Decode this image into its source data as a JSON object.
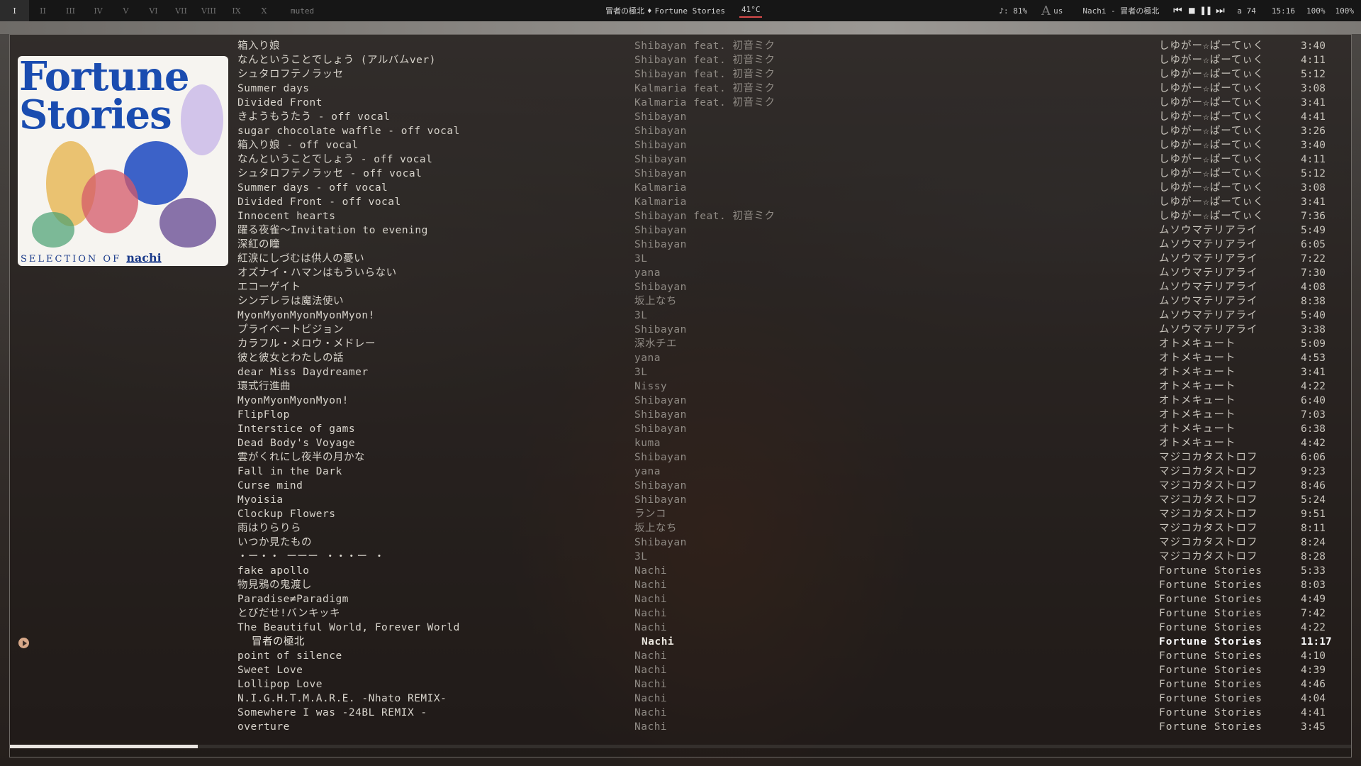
{
  "topbar": {
    "workspaces": [
      "I",
      "II",
      "III",
      "IV",
      "V",
      "VI",
      "VII",
      "VIII",
      "IX",
      "X"
    ],
    "active_workspace": "I",
    "mute_label": "muted",
    "now_playing_title": "冒者の極北",
    "now_playing_sep": "♦",
    "now_playing_album": "Fortune Stories",
    "temperature": "41°C",
    "volume_label": "♪: 81%",
    "keyboard_layout": "us",
    "window_title": "Nachi - 冒者の極北",
    "workspace_count": "a 74",
    "clock": "15:16",
    "brightness": "100%",
    "battery": "100%"
  },
  "album_art": {
    "title_line1": "Fortune",
    "title_line2": "Stories",
    "subtitle": "SELECTION OF",
    "artist": "nachi"
  },
  "playback": {
    "progress": 0.14
  },
  "tracks": [
    {
      "title": "箱入り娘",
      "artist": "Shibayan feat. 初音ミク",
      "album": "しゆがー☆ぱーてぃく",
      "duration": "3:40"
    },
    {
      "title": "なんということでしょう (アルバムver)",
      "artist": "Shibayan feat. 初音ミク",
      "album": "しゆがー☆ぱーてぃく",
      "duration": "4:11"
    },
    {
      "title": "シュタロフテノラッセ",
      "artist": "Shibayan feat. 初音ミク",
      "album": "しゆがー☆ぱーてぃく",
      "duration": "5:12"
    },
    {
      "title": "Summer days",
      "artist": "Kalmaria feat. 初音ミク",
      "album": "しゆがー☆ぱーてぃく",
      "duration": "3:08"
    },
    {
      "title": "Divided Front",
      "artist": "Kalmaria feat. 初音ミク",
      "album": "しゆがー☆ぱーてぃく",
      "duration": "3:41"
    },
    {
      "title": "きようもうたう - off vocal",
      "artist": "Shibayan",
      "album": "しゆがー☆ぱーてぃく",
      "duration": "4:41"
    },
    {
      "title": "sugar chocolate waffle - off vocal",
      "artist": "Shibayan",
      "album": "しゆがー☆ぱーてぃく",
      "duration": "3:26"
    },
    {
      "title": "箱入り娘 - off vocal",
      "artist": "Shibayan",
      "album": "しゆがー☆ぱーてぃく",
      "duration": "3:40"
    },
    {
      "title": "なんということでしょう - off vocal",
      "artist": "Shibayan",
      "album": "しゆがー☆ぱーてぃく",
      "duration": "4:11"
    },
    {
      "title": "シュタロフテノラッセ - off vocal",
      "artist": "Shibayan",
      "album": "しゆがー☆ぱーてぃく",
      "duration": "5:12"
    },
    {
      "title": "Summer days - off vocal",
      "artist": "Kalmaria",
      "album": "しゆがー☆ぱーてぃく",
      "duration": "3:08"
    },
    {
      "title": "Divided Front - off vocal",
      "artist": "Kalmaria",
      "album": "しゆがー☆ぱーてぃく",
      "duration": "3:41"
    },
    {
      "title": "Innocent hearts",
      "artist": "Shibayan feat. 初音ミク",
      "album": "しゆがー☆ぱーてぃく",
      "duration": "7:36"
    },
    {
      "title": "躍る夜雀〜Invitation to evening",
      "artist": "Shibayan",
      "album": "ムソウマテリアライ",
      "duration": "5:49"
    },
    {
      "title": "深紅の瞳",
      "artist": "Shibayan",
      "album": "ムソウマテリアライ",
      "duration": "6:05"
    },
    {
      "title": "紅涙にしづむは供人の憂い",
      "artist": "3L",
      "album": "ムソウマテリアライ",
      "duration": "7:22"
    },
    {
      "title": "オズナイ・ハマンはもういらない",
      "artist": "yana",
      "album": "ムソウマテリアライ",
      "duration": "7:30"
    },
    {
      "title": "エコーゲイト",
      "artist": "Shibayan",
      "album": "ムソウマテリアライ",
      "duration": "4:08"
    },
    {
      "title": "シンデレラは魔法使い",
      "artist": "坂上なち",
      "album": "ムソウマテリアライ",
      "duration": "8:38"
    },
    {
      "title": "MyonMyonMyonMyonMyon!",
      "artist": "3L",
      "album": "ムソウマテリアライ",
      "duration": "5:40"
    },
    {
      "title": "プライベートビジョン",
      "artist": "Shibayan",
      "album": "ムソウマテリアライ",
      "duration": "3:38"
    },
    {
      "title": "カラフル・メロウ・メドレー",
      "artist": "深水チエ",
      "album": "オトメキュート",
      "duration": "5:09"
    },
    {
      "title": "彼と彼女とわたしの話",
      "artist": "yana",
      "album": "オトメキュート",
      "duration": "4:53"
    },
    {
      "title": "dear Miss Daydreamer",
      "artist": "3L",
      "album": "オトメキュート",
      "duration": "3:41"
    },
    {
      "title": "環式行進曲",
      "artist": "Nissy",
      "album": "オトメキュート",
      "duration": "4:22"
    },
    {
      "title": "MyonMyonMyonMyon!",
      "artist": "Shibayan",
      "album": "オトメキュート",
      "duration": "6:40"
    },
    {
      "title": "FlipFlop",
      "artist": "Shibayan",
      "album": "オトメキュート",
      "duration": "7:03"
    },
    {
      "title": "Interstice of gams",
      "artist": "Shibayan",
      "album": "オトメキュート",
      "duration": "6:38"
    },
    {
      "title": "Dead Body's Voyage",
      "artist": "kuma",
      "album": "オトメキュート",
      "duration": "4:42"
    },
    {
      "title": "雲がくれにし夜半の月かな",
      "artist": "Shibayan",
      "album": "マジコカタストロフ",
      "duration": "6:06"
    },
    {
      "title": "Fall in the Dark",
      "artist": "yana",
      "album": "マジコカタストロフ",
      "duration": "9:23"
    },
    {
      "title": "Curse mind",
      "artist": "Shibayan",
      "album": "マジコカタストロフ",
      "duration": "8:46"
    },
    {
      "title": "Myoisia",
      "artist": "Shibayan",
      "album": "マジコカタストロフ",
      "duration": "5:24"
    },
    {
      "title": "Clockup Flowers",
      "artist": "ランコ",
      "album": "マジコカタストロフ",
      "duration": "9:51"
    },
    {
      "title": "雨はりらりら",
      "artist": "坂上なち",
      "album": "マジコカタストロフ",
      "duration": "8:11"
    },
    {
      "title": "いつか見たもの",
      "artist": "Shibayan",
      "album": "マジコカタストロフ",
      "duration": "8:24"
    },
    {
      "title": "・ー・・ ーーー ・・・ー ・",
      "artist": "3L",
      "album": "マジコカタストロフ",
      "duration": "8:28"
    },
    {
      "title": "fake apollo",
      "artist": "Nachi",
      "album": "Fortune Stories",
      "duration": "5:33"
    },
    {
      "title": "物見鴉の鬼渡し",
      "artist": "Nachi",
      "album": "Fortune Stories",
      "duration": "8:03"
    },
    {
      "title": "Paradise≠Paradigm",
      "artist": "Nachi",
      "album": "Fortune Stories",
      "duration": "4:49"
    },
    {
      "title": "とびだせ!バンキッキ",
      "artist": "Nachi",
      "album": "Fortune Stories",
      "duration": "7:42"
    },
    {
      "title": "The Beautiful World, Forever World",
      "artist": "Nachi",
      "album": "Fortune Stories",
      "duration": "4:22"
    },
    {
      "title": "冒者の極北",
      "artist": "Nachi",
      "album": "Fortune Stories",
      "duration": "11:17",
      "current": true
    },
    {
      "title": "point of silence",
      "artist": "Nachi",
      "album": "Fortune Stories",
      "duration": "4:10"
    },
    {
      "title": "Sweet Love",
      "artist": "Nachi",
      "album": "Fortune Stories",
      "duration": "4:39"
    },
    {
      "title": "Lollipop Love",
      "artist": "Nachi",
      "album": "Fortune Stories",
      "duration": "4:46"
    },
    {
      "title": "N.I.G.H.T.M.A.R.E. -Nhato REMIX-",
      "artist": "Nachi",
      "album": "Fortune Stories",
      "duration": "4:04"
    },
    {
      "title": "Somewhere I was -24BL REMIX -",
      "artist": "Nachi",
      "album": "Fortune Stories",
      "duration": "4:41"
    },
    {
      "title": "overture",
      "artist": "Nachi",
      "album": "Fortune Stories",
      "duration": "3:45"
    }
  ]
}
